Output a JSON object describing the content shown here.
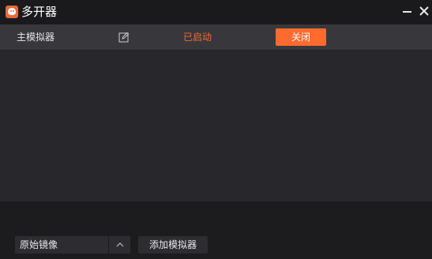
{
  "window": {
    "title": "多开器",
    "icon": "multi-instance-app-icon",
    "controls": {
      "minimize_icon": "minimize-icon",
      "close_icon": "close-icon"
    }
  },
  "emulators": [
    {
      "name": "主模拟器",
      "edit_icon": "edit-icon",
      "status": "已启动",
      "action_label": "关闭"
    }
  ],
  "footer": {
    "image_select": {
      "selected": "原始镜像",
      "arrow_icon": "chevron-up-icon"
    },
    "add_button_label": "添加模拟器"
  },
  "colors": {
    "accent": "#ff6b2e",
    "status_running": "#f06a33",
    "background": "#1c1c1f",
    "row_background": "#38383c",
    "list_background": "#28282c"
  }
}
